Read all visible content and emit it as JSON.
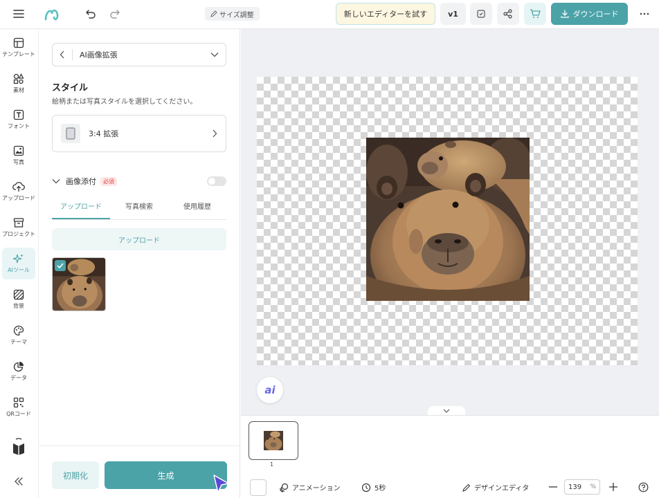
{
  "topbar": {
    "size_label": "サイズ調整",
    "new_editor_label": "新しいエディターを試す",
    "version_label": "v1",
    "download_label": "ダウンロード"
  },
  "leftnav": {
    "items": [
      {
        "label": "テンプレート",
        "icon": "template-icon"
      },
      {
        "label": "素材",
        "icon": "elements-icon"
      },
      {
        "label": "フォント",
        "icon": "text-icon"
      },
      {
        "label": "写真",
        "icon": "photo-icon"
      },
      {
        "label": "アップロード",
        "icon": "upload-icon"
      },
      {
        "label": "プロジェクト",
        "icon": "project-icon"
      },
      {
        "label": "AIツール",
        "icon": "ai-sparkle-icon"
      },
      {
        "label": "背景",
        "icon": "background-icon"
      },
      {
        "label": "テーマ",
        "icon": "palette-icon"
      },
      {
        "label": "データ",
        "icon": "chart-icon"
      },
      {
        "label": "QRコード",
        "icon": "qr-icon"
      }
    ],
    "active_index": 6
  },
  "panel": {
    "dropdown_label": "AI画像拡張",
    "style_title": "スタイル",
    "style_desc": "絵柄または写真スタイルを選択してください。",
    "style_option": "3:4 拡張",
    "attach_label": "画像添付",
    "required_badge": "必須",
    "tabs": [
      {
        "label": "アップロード",
        "active": true
      },
      {
        "label": "写真検索",
        "active": false
      },
      {
        "label": "使用履歴",
        "active": false
      }
    ],
    "upload_button": "アップロード",
    "reset_button": "初期化",
    "generate_button": "生成"
  },
  "canvas": {
    "ai_button": "ai"
  },
  "pages": {
    "page_number": "1"
  },
  "bottombar": {
    "animation_label": "アニメーション",
    "duration_label": "5秒",
    "design_editor_label": "デザインエディタ",
    "zoom_value": "139",
    "zoom_unit": "%"
  },
  "colors": {
    "accent": "#4ba3a8",
    "canvas_bg": "#eef0f3"
  }
}
